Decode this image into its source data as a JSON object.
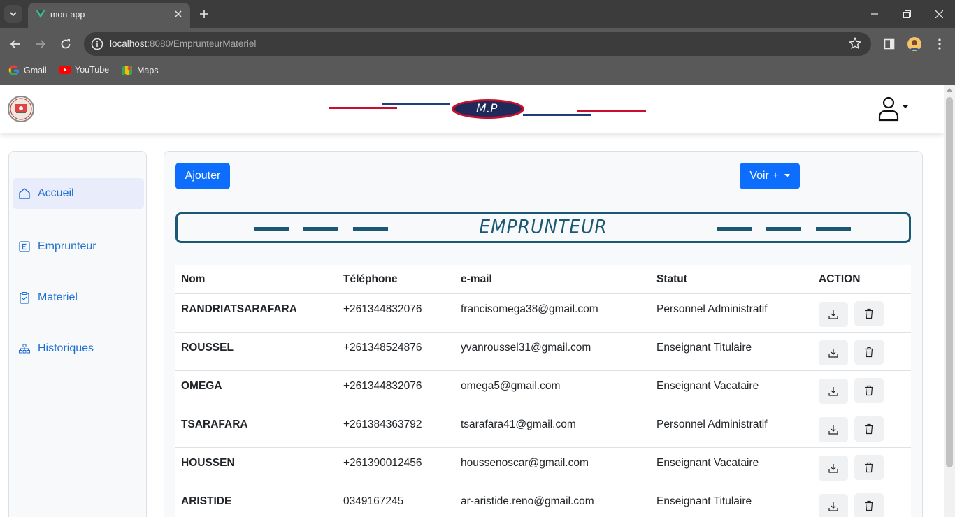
{
  "browser": {
    "tab_title": "mon-app",
    "url_host": "localhost",
    "url_path": ":8080/EmprunteurMateriel",
    "bookmarks": [
      "Gmail",
      "YouTube",
      "Maps"
    ]
  },
  "navbar": {
    "brand_text": "M.P",
    "colors": {
      "red": "#c8102e",
      "navy": "#1f3d7a"
    }
  },
  "sidebar": {
    "items": [
      {
        "label": "Accueil",
        "icon": "home-icon",
        "active": true
      },
      {
        "label": "Emprunteur",
        "icon": "letter-e-icon",
        "active": false
      },
      {
        "label": "Materiel",
        "icon": "clipboard-icon",
        "active": false
      },
      {
        "label": "Historiques",
        "icon": "sitemap-icon",
        "active": false
      }
    ]
  },
  "main": {
    "add_button": "Ajouter",
    "view_button": "Voir +",
    "banner_title": "EMPRUNTEUR",
    "table": {
      "headers": [
        "Nom",
        "Téléphone",
        "e-mail",
        "Statut",
        "ACTION"
      ],
      "rows": [
        {
          "nom": "RANDRIATSARAFARA",
          "tel": "+261344832076",
          "email": "francisomega38@gmail.com",
          "statut": "Personnel Administratif"
        },
        {
          "nom": "ROUSSEL",
          "tel": "+261348524876",
          "email": "yvanroussel31@gmail.com",
          "statut": "Enseignant Titulaire"
        },
        {
          "nom": "OMEGA",
          "tel": "+261344832076",
          "email": "omega5@gmail.com",
          "statut": "Enseignant Vacataire"
        },
        {
          "nom": "TSARAFARA",
          "tel": "+261384363792",
          "email": "tsarafara41@gmail.com",
          "statut": "Personnel Administratif"
        },
        {
          "nom": "HOUSSEN",
          "tel": "+261390012456",
          "email": "houssenoscar@gmail.com",
          "statut": "Enseignant Vacataire"
        },
        {
          "nom": "ARISTIDE",
          "tel": "0349167245",
          "email": "ar-aristide.reno@gmail.com",
          "statut": "Enseignant Titulaire"
        }
      ]
    }
  },
  "theme": {
    "primary": "#0d6efd",
    "banner": "#1a5876"
  }
}
